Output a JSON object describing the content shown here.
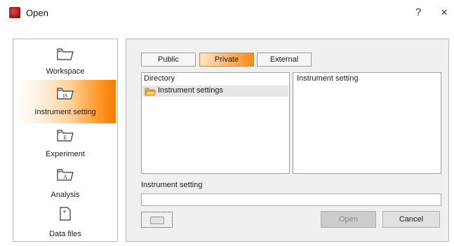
{
  "window": {
    "title": "Open",
    "help_glyph": "?",
    "close_glyph": "×",
    "icon": "app-logo-icon"
  },
  "nav": {
    "items": [
      {
        "label": "Workspace",
        "icon": "folder-icon",
        "active": false
      },
      {
        "label": "Instrument setting",
        "icon": "folder-is-icon",
        "icon_text": "IS",
        "active": true
      },
      {
        "label": "Experiment",
        "icon": "folder-e-icon",
        "icon_text": "E",
        "active": false
      },
      {
        "label": "Analysis",
        "icon": "folder-a-icon",
        "icon_text": "A",
        "active": false
      },
      {
        "label": "Data files",
        "icon": "file-plus-icon",
        "icon_text": "+",
        "active": false
      }
    ]
  },
  "tabs": [
    {
      "label": "Public",
      "selected": false
    },
    {
      "label": "Private",
      "selected": true
    },
    {
      "label": "External",
      "selected": false
    }
  ],
  "directory": {
    "header": "Directory",
    "rows": [
      {
        "label": "Instrument settings",
        "icon": "folder-open-icon"
      }
    ]
  },
  "setting_list": {
    "header": "Instrument setting"
  },
  "name_field": {
    "label": "Instrument setting",
    "value": ""
  },
  "buttons": {
    "open": "Open",
    "cancel": "Cancel",
    "open_enabled": false
  },
  "colors": {
    "accent": "#f67a00",
    "selection_grey": "#e6e6e6"
  }
}
